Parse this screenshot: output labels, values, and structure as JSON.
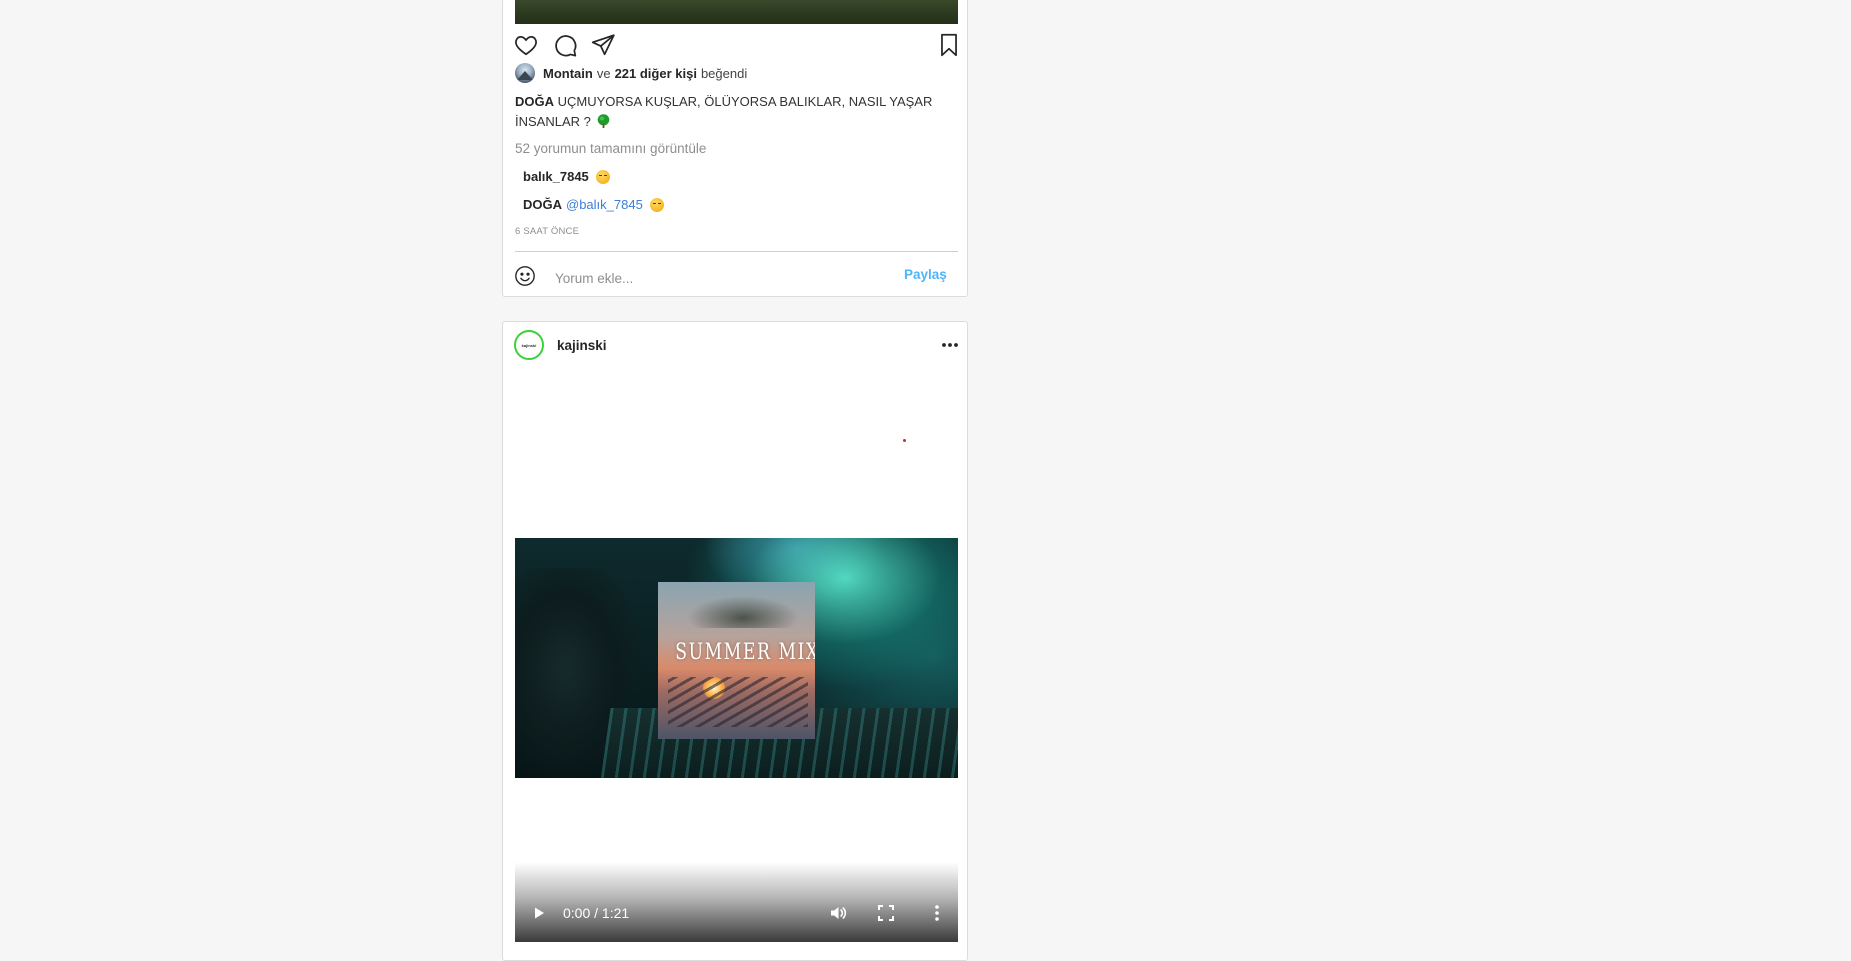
{
  "post1": {
    "likes": {
      "first_liker": "Montain",
      "connector": "ve",
      "others": "221 diğer kişi",
      "suffix": "beğendi"
    },
    "caption": {
      "author": "DOĞA",
      "text": "UÇMUYORSA KUŞLAR, ÖLÜYORSA BALIKLAR, NASIL YAŞAR İNSANLAR ?"
    },
    "view_all_comments": "52 yorumun tamamını görüntüle",
    "comments": [
      {
        "author": "balık_7845",
        "mention": "",
        "emoji": "expressionless-face"
      },
      {
        "author": "DOĞA",
        "mention": "@balık_7845",
        "emoji": "confused-face"
      }
    ],
    "time_ago": "6 SAAT ÖNCE",
    "comment_box": {
      "placeholder": "Yorum ekle...",
      "share_label": "Paylaş"
    },
    "icons": [
      "heart-icon",
      "comment-icon",
      "share-icon",
      "bookmark-icon",
      "smiley-icon"
    ]
  },
  "post2": {
    "author": "kajinski",
    "avatar_text": "kajinski",
    "video": {
      "overlay_title": "SUMMER MIX",
      "time": "0:00 / 1:21"
    },
    "icons": [
      "more-icon",
      "play-icon",
      "volume-icon",
      "fullscreen-icon",
      "kebab-menu-icon"
    ]
  },
  "colors": {
    "background": "#f6f6f6",
    "link_blue": "#3c7fd9",
    "share_button": "#4db5f9",
    "avatar_ring": "#3bd13b"
  }
}
